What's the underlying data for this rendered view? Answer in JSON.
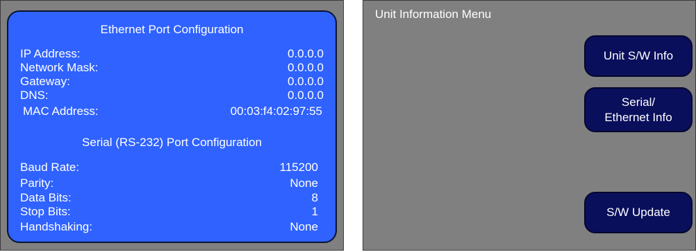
{
  "left_panel": {
    "ethernet_title": "Ethernet Port Configuration",
    "ethernet_rows": [
      {
        "label": "IP Address:",
        "value": "0.0.0.0"
      },
      {
        "label": "Network Mask:",
        "value": "0.0.0.0"
      },
      {
        "label": "Gateway:",
        "value": "0.0.0.0"
      },
      {
        "label": "DNS:",
        "value": "0.0.0.0"
      },
      {
        "label": "MAC Address:",
        "value": "00:03:f4:02:97:55"
      }
    ],
    "serial_title": "Serial (RS-232) Port Configuration",
    "serial_rows": [
      {
        "label": "Baud Rate:",
        "value": "115200"
      },
      {
        "label": "Parity:",
        "value": "None"
      },
      {
        "label": "Data Bits:",
        "value": "8"
      },
      {
        "label": "Stop Bits:",
        "value": "1"
      },
      {
        "label": "Handshaking:",
        "value": "None"
      }
    ]
  },
  "right_panel": {
    "menu_title": "Unit Information Menu",
    "buttons": {
      "unit_sw_info": "Unit S/W Info",
      "serial_ethernet_line1": "Serial/",
      "serial_ethernet_line2": "Ethernet Info",
      "sw_update": "S/W Update"
    }
  },
  "colors": {
    "screen_bg": "#808080",
    "panel_bg": "#2f62ff",
    "button_bg": "#0a0f5c",
    "text": "#ffffff"
  }
}
